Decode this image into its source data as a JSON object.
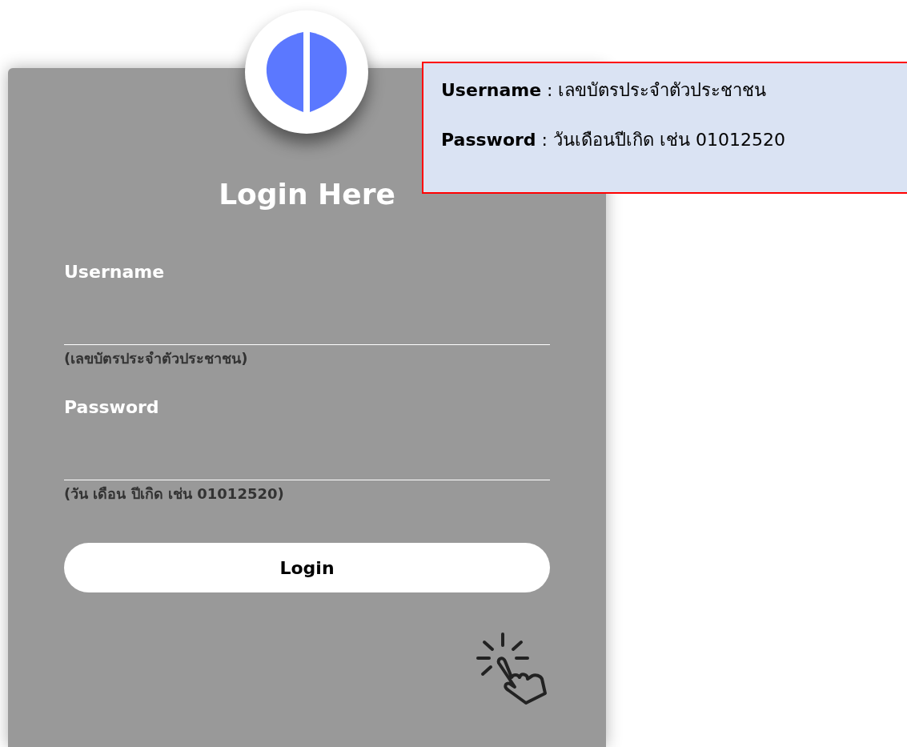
{
  "login_card": {
    "title": "Login Here",
    "fields": [
      {
        "label": "Username",
        "hint": "(เลขบัตรประจำตัวประชาชน)"
      },
      {
        "label": "Password",
        "hint": "(วัน เดือน ปีเกิด เช่น 01012520)"
      }
    ],
    "button": "Login"
  },
  "info_box": {
    "lines": [
      "**Username** : เลขบัตรประจำตัวประชาชน",
      "**Password** : วันเดือนปีเกิด เช่น 01012520"
    ]
  }
}
